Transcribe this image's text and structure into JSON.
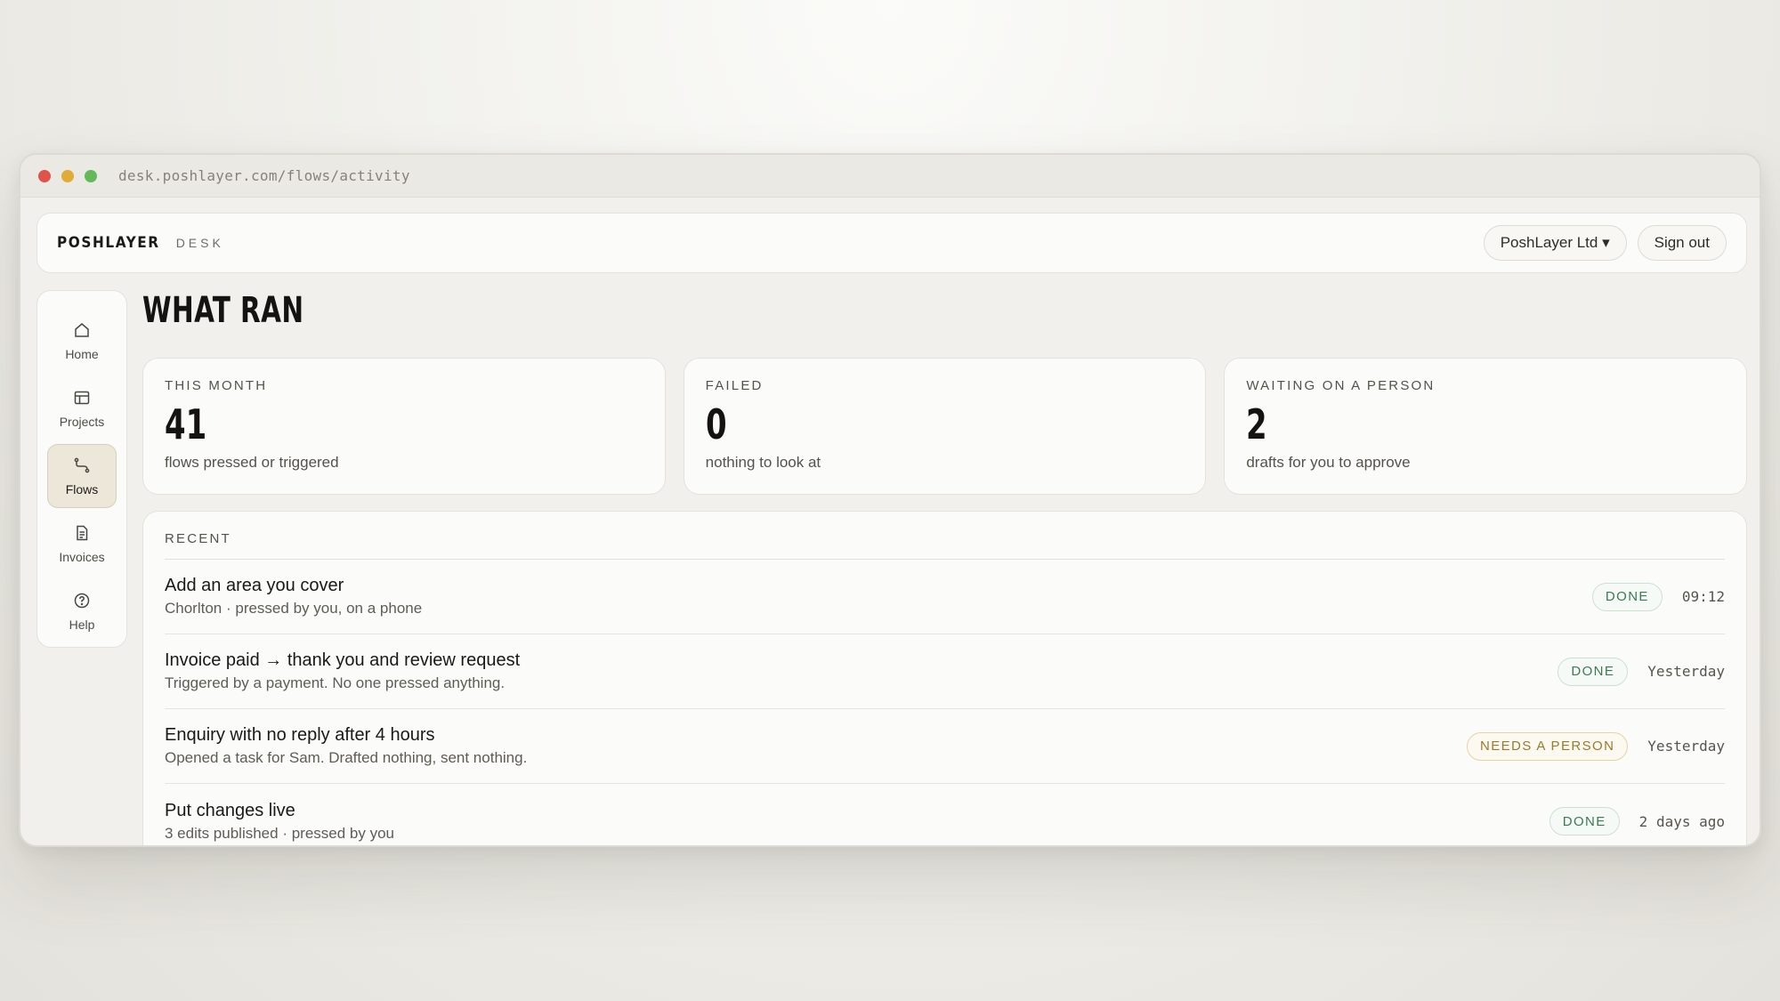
{
  "browser": {
    "url": "desk.poshlayer.com/flows/activity"
  },
  "header": {
    "brand": "POSHLAYER",
    "brand_sub": "DESK",
    "org_switcher": "PoshLayer Ltd ▾",
    "sign_out": "Sign out"
  },
  "sidebar": {
    "items": [
      {
        "label": "Home",
        "icon": "home-icon",
        "active": false
      },
      {
        "label": "Projects",
        "icon": "table-icon",
        "active": false
      },
      {
        "label": "Flows",
        "icon": "flow-icon",
        "active": true
      },
      {
        "label": "Invoices",
        "icon": "document-icon",
        "active": false
      },
      {
        "label": "Help",
        "icon": "help-icon",
        "active": false
      }
    ]
  },
  "page": {
    "title": "WHAT RAN"
  },
  "stats": [
    {
      "label": "THIS MONTH",
      "value": "41",
      "caption": "flows pressed or triggered"
    },
    {
      "label": "FAILED",
      "value": "0",
      "caption": "nothing to look at"
    },
    {
      "label": "WAITING ON A PERSON",
      "value": "2",
      "caption": "drafts for you to approve"
    }
  ],
  "recent": {
    "label": "RECENT",
    "rows": [
      {
        "title": "Add an area you cover",
        "subtitle": "Chorlton · pressed by you, on a phone",
        "status": "DONE",
        "status_type": "done",
        "time": "09:12"
      },
      {
        "title": "Invoice paid → thank you and review request",
        "subtitle": "Triggered by a payment. No one pressed anything.",
        "status": "DONE",
        "status_type": "done",
        "time": "Yesterday"
      },
      {
        "title": "Enquiry with no reply after 4 hours",
        "subtitle": "Opened a task for Sam. Drafted nothing, sent nothing.",
        "status": "NEEDS A PERSON",
        "status_type": "needs",
        "time": "Yesterday"
      },
      {
        "title": "Put changes live",
        "subtitle": "3 edits published · pressed by you",
        "status": "DONE",
        "status_type": "done",
        "time": "2 days ago"
      }
    ]
  },
  "colors": {
    "done": "#3c7a55",
    "needs_person": "#9c7a2c",
    "active_nav": "#ece7d9"
  }
}
